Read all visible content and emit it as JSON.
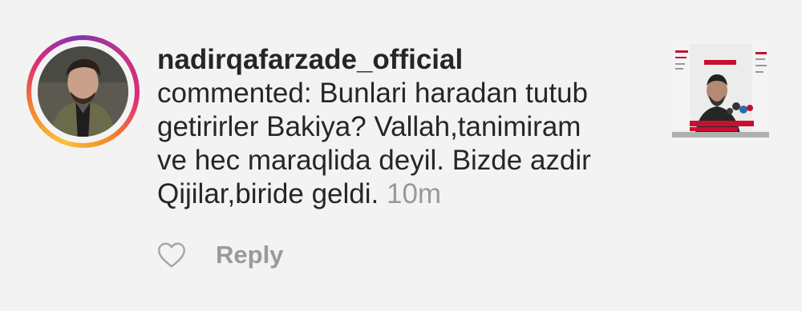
{
  "notification": {
    "username": "nadirqafarzade_official",
    "comment_lines": [
      "commented: Bunlari haradan tutub",
      "getirirler Bakiya? Vallah,tanimiram",
      "ve hec maraqlida deyil. Bizde azdir",
      "Qijilar,biride geldi."
    ],
    "timestamp": "10m",
    "avatar_icon": "profile-photo",
    "thumbnail_icon": "post-thumbnail"
  },
  "actions": {
    "like_icon": "heart-outline-icon",
    "reply_label": "Reply"
  },
  "colors": {
    "background": "#f3f3f3",
    "text": "#262626",
    "muted": "#999999",
    "story_ring_start": "#f9c23c",
    "story_ring_end": "#8134af"
  }
}
